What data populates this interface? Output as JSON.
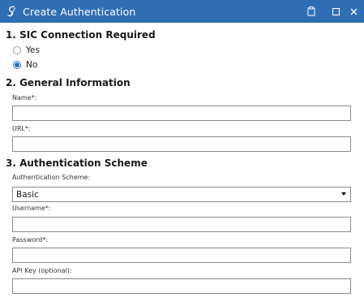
{
  "window": {
    "title": "Create Authentication",
    "icons": {
      "app": "swirl-logo-icon",
      "pin": "clipboard-icon",
      "maximize": "maximize-icon",
      "close": "close-icon"
    },
    "colors": {
      "titlebar": "#2f6eb5",
      "radio_selected": "#2f6eb5"
    }
  },
  "sections": {
    "sic": {
      "title": "1. SIC Connection Required",
      "options": [
        {
          "label": "Yes",
          "selected": false
        },
        {
          "label": "No",
          "selected": true
        }
      ]
    },
    "general": {
      "title": "2. General Information",
      "name_label": "Name*:",
      "name_value": "",
      "url_label": "URL*:",
      "url_value": ""
    },
    "auth": {
      "title": "3. Authentication Scheme",
      "scheme_label": "Authentication Scheme:",
      "scheme_value": "Basic",
      "username_label": "Username*:",
      "username_value": "",
      "password_label": "Password*:",
      "password_value": "",
      "apikey_label": "API Key (optional):",
      "apikey_value": ""
    }
  }
}
